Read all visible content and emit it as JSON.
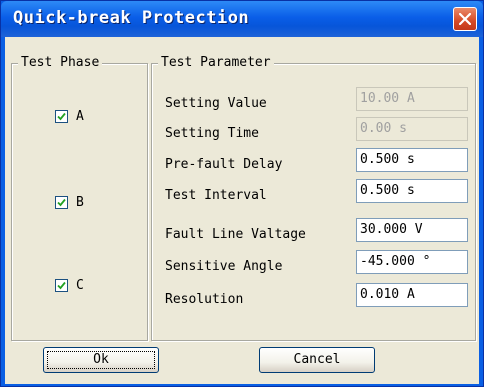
{
  "window": {
    "title": "Quick-break Protection"
  },
  "test_phase": {
    "label": "Test Phase",
    "phases": [
      {
        "label": "A",
        "checked": true
      },
      {
        "label": "B",
        "checked": true
      },
      {
        "label": "C",
        "checked": true
      }
    ]
  },
  "test_parameter": {
    "label": "Test Parameter",
    "rows": [
      {
        "label": "Setting Value",
        "value": "10.00 A",
        "enabled": false
      },
      {
        "label": "Setting Time",
        "value": "0.00 s",
        "enabled": false
      },
      {
        "label": "Pre-fault Delay",
        "value": "0.500 s",
        "enabled": true
      },
      {
        "label": "Test Interval",
        "value": "0.500 s",
        "enabled": true
      },
      {
        "label": "Fault Line Valtage",
        "value": "30.000 V",
        "enabled": true
      },
      {
        "label": "Sensitive Angle",
        "value": "-45.000 °",
        "enabled": true
      },
      {
        "label": "Resolution",
        "value": "0.010 A",
        "enabled": true
      }
    ]
  },
  "buttons": {
    "ok": "Ok",
    "cancel": "Cancel"
  },
  "colors": {
    "title_bar": "#0a5fe4",
    "dialog_face": "#ece9d8",
    "close_button": "#d64a26"
  }
}
